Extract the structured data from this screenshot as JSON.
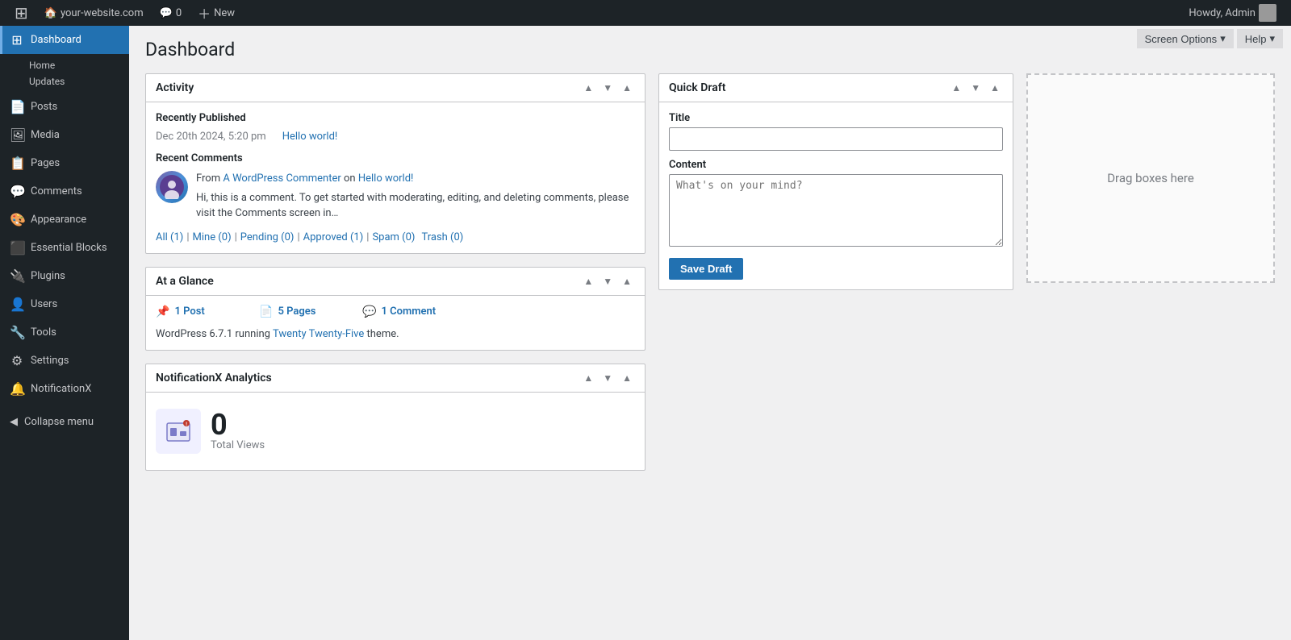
{
  "adminbar": {
    "wp_logo": "⊞",
    "site_url": "your-website.com",
    "comments_label": "Comments",
    "comments_count": "0",
    "new_label": "New",
    "howdy": "Howdy, Admin"
  },
  "screen_options": {
    "label": "Screen Options",
    "arrow": "▾"
  },
  "help": {
    "label": "Help",
    "arrow": "▾"
  },
  "page_title": "Dashboard",
  "sidebar": {
    "current_item": "Dashboard",
    "items": [
      {
        "id": "dashboard",
        "label": "Dashboard",
        "icon": "⊞"
      },
      {
        "id": "posts",
        "label": "Posts",
        "icon": "📄"
      },
      {
        "id": "media",
        "label": "Media",
        "icon": "🖼"
      },
      {
        "id": "pages",
        "label": "Pages",
        "icon": "📋"
      },
      {
        "id": "comments",
        "label": "Comments",
        "icon": "💬"
      },
      {
        "id": "appearance",
        "label": "Appearance",
        "icon": "🎨"
      },
      {
        "id": "essential-blocks",
        "label": "Essential Blocks",
        "icon": "⬛"
      },
      {
        "id": "plugins",
        "label": "Plugins",
        "icon": "🔌"
      },
      {
        "id": "users",
        "label": "Users",
        "icon": "👤"
      },
      {
        "id": "tools",
        "label": "Tools",
        "icon": "🔧"
      },
      {
        "id": "settings",
        "label": "Settings",
        "icon": "⚙"
      },
      {
        "id": "notificationx",
        "label": "NotificationX",
        "icon": "🔔"
      }
    ],
    "sub_home": "Home",
    "sub_updates": "Updates",
    "collapse_label": "Collapse menu"
  },
  "activity": {
    "title": "Activity",
    "recently_published_heading": "Recently Published",
    "published_date": "Dec 20th 2024, 5:20 pm",
    "published_link": "Hello world!",
    "recent_comments_heading": "Recent Comments",
    "commenter_label": "From",
    "commenter_name": "A WordPress Commenter",
    "commenter_on": "on",
    "commenter_post": "Hello world!",
    "comment_text": "Hi, this is a comment. To get started with moderating, editing, and deleting comments, please visit the Comments screen in…",
    "filters": [
      {
        "label": "All (1)",
        "id": "all"
      },
      {
        "label": "Mine (0)",
        "id": "mine"
      },
      {
        "label": "Pending (0)",
        "id": "pending"
      },
      {
        "label": "Approved (1)",
        "id": "approved"
      },
      {
        "label": "Spam (0)",
        "id": "spam"
      },
      {
        "label": "Trash (0)",
        "id": "trash"
      }
    ]
  },
  "quick_draft": {
    "title": "Quick Draft",
    "title_label": "Title",
    "title_placeholder": "",
    "content_label": "Content",
    "content_placeholder": "What's on your mind?",
    "save_label": "Save Draft"
  },
  "at_a_glance": {
    "title": "At a Glance",
    "posts_count": "1 Post",
    "pages_count": "5 Pages",
    "comments_count": "1 Comment",
    "wp_version": "WordPress 6.7.1",
    "running_text": "running",
    "theme_name": "Twenty Twenty-Five",
    "theme_suffix": "theme."
  },
  "notification_x": {
    "title": "NotificationX Analytics",
    "total_views_count": "0",
    "total_views_label": "Total Views"
  },
  "drag_area": {
    "text": "Drag boxes here"
  }
}
